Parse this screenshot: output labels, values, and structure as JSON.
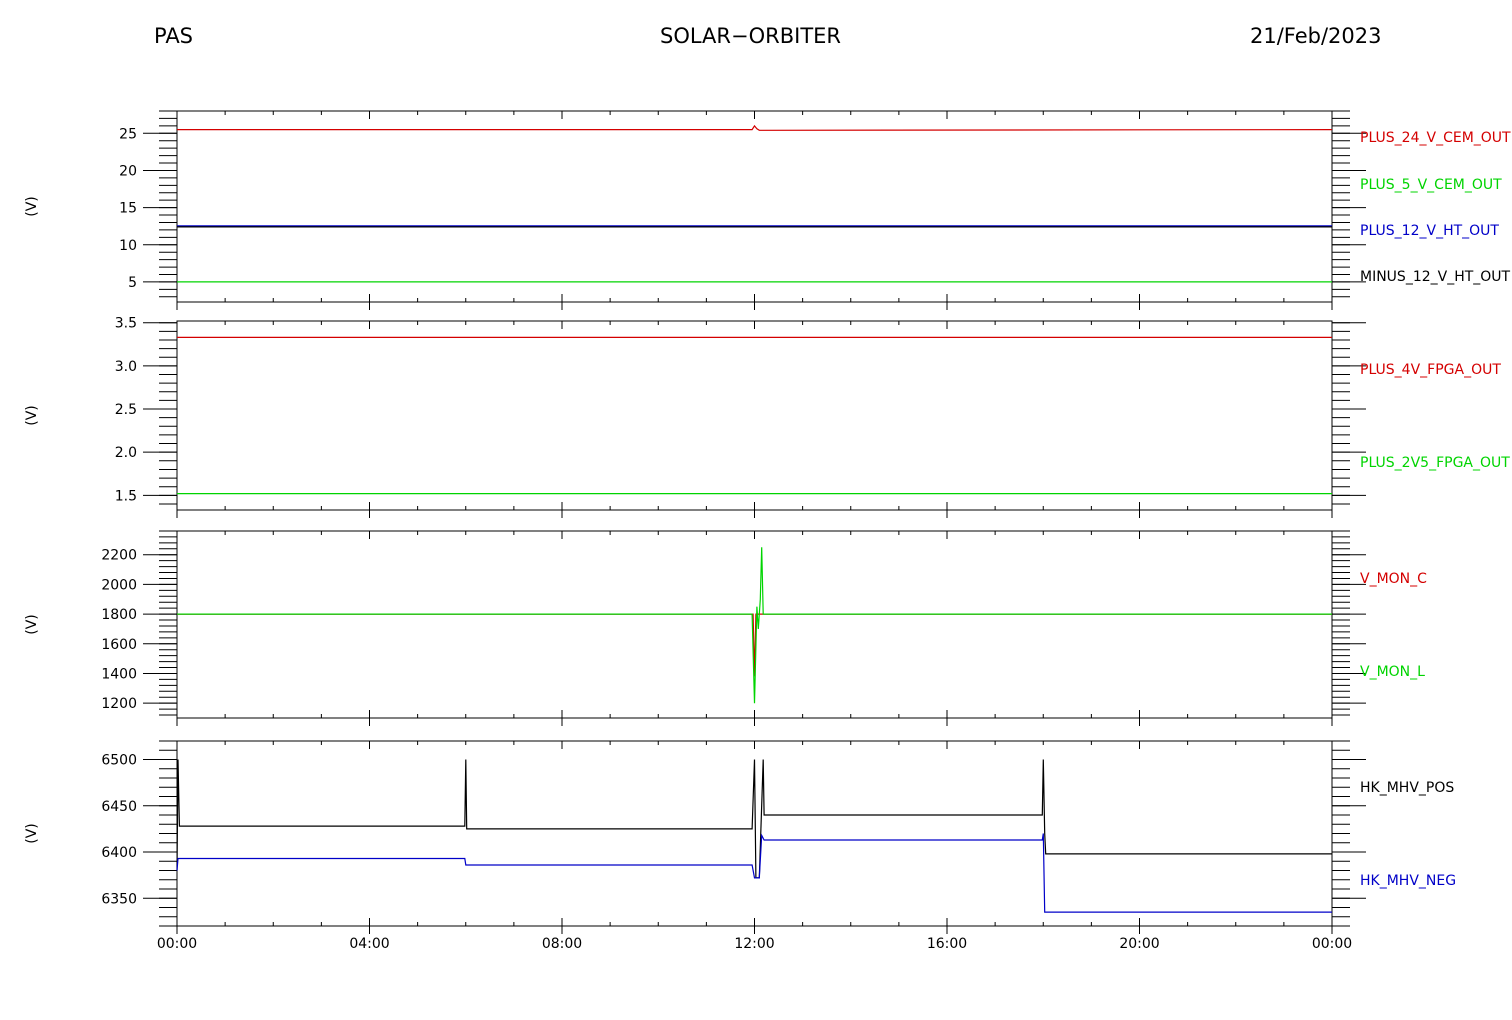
{
  "header": {
    "left": "PAS",
    "center": "SOLAR−ORBITER",
    "right": "21/Feb/2023"
  },
  "colors": {
    "red": "#d40000",
    "green": "#00d400",
    "blue": "#0000c8",
    "black": "#000000"
  },
  "chart_data": [
    {
      "type": "line",
      "ylabel": "(V)",
      "ylim": [
        2.3,
        28.0
      ],
      "yticks": [
        5,
        10,
        15,
        20,
        25
      ],
      "xlim": [
        0,
        24
      ],
      "series": [
        {
          "name": "PLUS_24_V_CEM_OUT",
          "color": "red",
          "x": [
            0,
            11.95,
            12.0,
            12.05,
            12.1,
            24
          ],
          "y": [
            25.5,
            25.5,
            26.0,
            25.6,
            25.4,
            25.5
          ]
        },
        {
          "name": "PLUS_5_V_CEM_OUT",
          "color": "green",
          "x": [
            0,
            24
          ],
          "y": [
            5.0,
            5.0
          ]
        },
        {
          "name": "PLUS_12_V_HT_OUT",
          "color": "blue",
          "x": [
            0,
            24
          ],
          "y": [
            12.5,
            12.5
          ]
        },
        {
          "name": "MINUS_12_V_HT_OUT",
          "color": "black",
          "x": [
            0,
            24
          ],
          "y": [
            12.4,
            12.4
          ]
        }
      ]
    },
    {
      "type": "line",
      "ylabel": "(V)",
      "ylim": [
        1.33,
        3.52
      ],
      "yticks": [
        1.5,
        2.0,
        2.5,
        3.0,
        3.5
      ],
      "tickfmt": 1,
      "xlim": [
        0,
        24
      ],
      "series": [
        {
          "name": "PLUS_4V_FPGA_OUT",
          "color": "red",
          "x": [
            0,
            24
          ],
          "y": [
            3.33,
            3.33
          ]
        },
        {
          "name": "PLUS_2V5_FPGA_OUT",
          "color": "green",
          "x": [
            0,
            24
          ],
          "y": [
            1.52,
            1.52
          ]
        }
      ]
    },
    {
      "type": "line",
      "ylabel": "(V)",
      "ylim": [
        1100,
        2360
      ],
      "yticks": [
        1200,
        1400,
        1600,
        1800,
        2000,
        2200
      ],
      "xlim": [
        0,
        24
      ],
      "series": [
        {
          "name": "V_MON_C",
          "color": "red",
          "x": [
            0,
            11.97,
            12.0,
            12.03,
            24
          ],
          "y": [
            1800,
            1800,
            1380,
            1800,
            1800
          ]
        },
        {
          "name": "V_MON_L",
          "color": "green",
          "x": [
            0,
            11.95,
            12.0,
            12.05,
            12.08,
            12.12,
            12.15,
            12.18,
            24
          ],
          "y": [
            1800,
            1800,
            1200,
            1850,
            1700,
            1900,
            2250,
            1800,
            1800
          ]
        }
      ]
    },
    {
      "type": "line",
      "ylabel": "(V)",
      "ylim": [
        6320,
        6520
      ],
      "yticks": [
        6350,
        6400,
        6450,
        6500
      ],
      "xlim": [
        0,
        24
      ],
      "series": [
        {
          "name": "HK_MHV_POS",
          "color": "black",
          "x": [
            0,
            0.02,
            0.05,
            0.1,
            5.98,
            6.0,
            6.02,
            6.05,
            11.95,
            12.0,
            12.03,
            12.1,
            12.18,
            12.2,
            17.98,
            18.0,
            18.03,
            18.05,
            24
          ],
          "y": [
            6380,
            6500,
            6428,
            6428,
            6428,
            6500,
            6425,
            6425,
            6425,
            6500,
            6372,
            6372,
            6500,
            6440,
            6440,
            6500,
            6420,
            6398,
            6398
          ]
        },
        {
          "name": "HK_MHV_NEG",
          "color": "blue",
          "x": [
            0,
            0.02,
            0.05,
            0.1,
            5.98,
            6.0,
            6.05,
            11.95,
            12.0,
            12.03,
            12.1,
            12.15,
            12.2,
            17.98,
            18.0,
            18.03,
            18.05,
            24
          ],
          "y": [
            6380,
            6393,
            6393,
            6393,
            6393,
            6386,
            6386,
            6386,
            6372,
            6372,
            6372,
            6418,
            6413,
            6413,
            6420,
            6335,
            6335,
            6335
          ]
        }
      ]
    }
  ],
  "xaxis": {
    "ticks": [
      {
        "x": 0,
        "label": "00:00"
      },
      {
        "x": 4,
        "label": "04:00"
      },
      {
        "x": 8,
        "label": "08:00"
      },
      {
        "x": 12,
        "label": "12:00"
      },
      {
        "x": 16,
        "label": "16:00"
      },
      {
        "x": 20,
        "label": "20:00"
      },
      {
        "x": 24,
        "label": "00:00"
      }
    ]
  }
}
